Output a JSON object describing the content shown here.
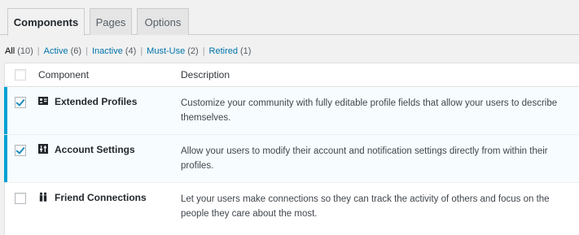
{
  "tabs": [
    {
      "label": "Components",
      "active": true
    },
    {
      "label": "Pages",
      "active": false
    },
    {
      "label": "Options",
      "active": false
    }
  ],
  "filters": [
    {
      "label": "All",
      "count": "(10)",
      "current": true
    },
    {
      "label": "Active",
      "count": "(6)",
      "current": false
    },
    {
      "label": "Inactive",
      "count": "(4)",
      "current": false
    },
    {
      "label": "Must-Use",
      "count": "(2)",
      "current": false
    },
    {
      "label": "Retired",
      "count": "(1)",
      "current": false
    }
  ],
  "filter_separator": "|",
  "table": {
    "columns": {
      "component": "Component",
      "description": "Description"
    },
    "rows": [
      {
        "name": "Extended Profiles",
        "icon": "profile-card-icon",
        "checked": true,
        "active": true,
        "description": "Customize your community with fully editable profile fields that allow your users to describe themselves."
      },
      {
        "name": "Account Settings",
        "icon": "settings-sliders-icon",
        "checked": true,
        "active": true,
        "description": "Allow your users to modify their account and notification settings directly from within their profiles."
      },
      {
        "name": "Friend Connections",
        "icon": "friends-icon",
        "checked": false,
        "active": false,
        "description": "Let your users make connections so they can track the activity of others and focus on the people they care about the most."
      }
    ]
  },
  "colors": {
    "link": "#0073aa",
    "active_border": "#00a0d2",
    "active_row_bg": "#f7fcfe",
    "checkmark": "#1e8cbe"
  }
}
